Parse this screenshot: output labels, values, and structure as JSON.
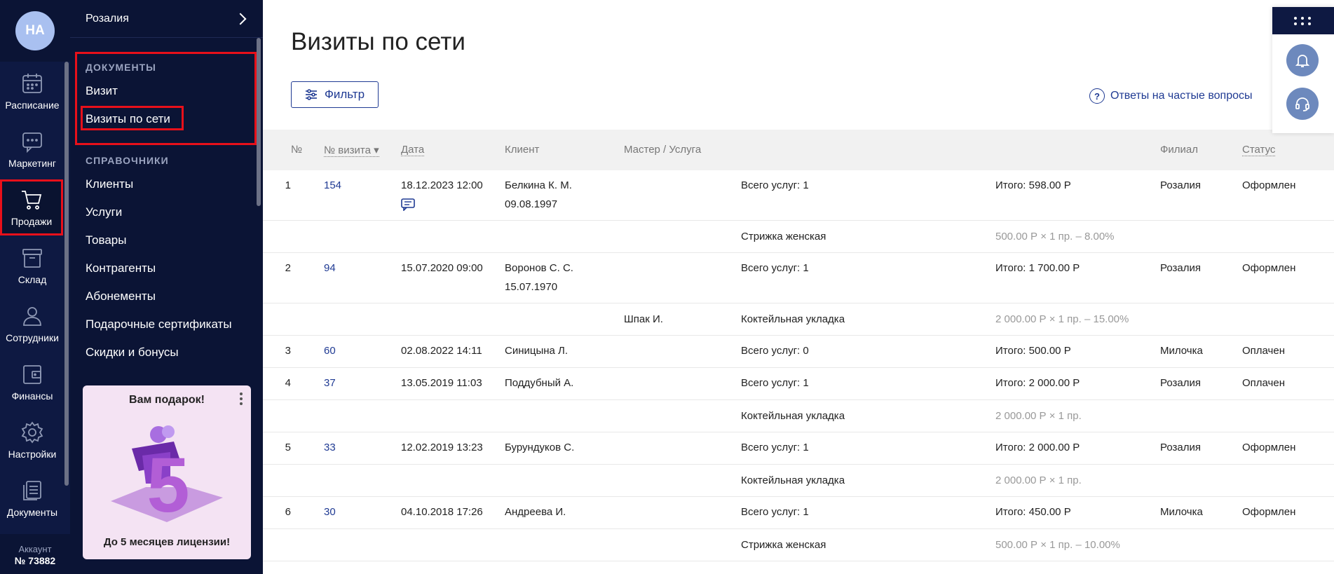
{
  "user": {
    "initials": "НА"
  },
  "rail": {
    "items": [
      {
        "label": "Расписание",
        "icon": "calendar-icon"
      },
      {
        "label": "Маркетинг",
        "icon": "chat-icon"
      },
      {
        "label": "Продажи",
        "icon": "cart-icon",
        "active": true
      },
      {
        "label": "Склад",
        "icon": "box-icon"
      },
      {
        "label": "Сотрудники",
        "icon": "person-icon"
      },
      {
        "label": "Финансы",
        "icon": "wallet-icon"
      },
      {
        "label": "Настройки",
        "icon": "gear-icon"
      },
      {
        "label": "Документы",
        "icon": "documents-icon"
      }
    ],
    "account_label": "Аккаунт",
    "account_number": "№ 73882"
  },
  "submenu": {
    "branch": "Розалия",
    "section_documents": "ДОКУМЕНТЫ",
    "documents": [
      "Визит",
      "Визиты по сети"
    ],
    "section_refs": "СПРАВОЧНИКИ",
    "refs": [
      "Клиенты",
      "Услуги",
      "Товары",
      "Контрагенты",
      "Абонементы",
      "Подарочные сертификаты",
      "Скидки и бонусы"
    ],
    "promo": {
      "title": "Вам подарок!",
      "digit": "5",
      "text": "До 5 месяцев лицензии!"
    }
  },
  "main": {
    "title": "Визиты по сети",
    "filter_label": "Фильтр",
    "faq_label": "Ответы на частые вопросы",
    "columns": [
      "№",
      "№ визита ▾",
      "Дата",
      "Клиент",
      "Мастер / Услуга",
      "Филиал",
      "Статус"
    ]
  },
  "rows": [
    {
      "n": "1",
      "visit": "154",
      "date": "18.12.2023 12:00",
      "client": "Белкина К. М.",
      "client2": "09.08.1997",
      "services": "Всего услуг: 1",
      "total": "Итого: 598.00 Р",
      "branch": "Розалия",
      "status": "Оформлен",
      "sub": [
        {
          "master": "",
          "service": "Стрижка женская",
          "price": "500.00 Р × 1 пр. – 8.00%"
        }
      ]
    },
    {
      "n": "2",
      "visit": "94",
      "date": "15.07.2020 09:00",
      "client": "Воронов С. С.",
      "client2": "15.07.1970",
      "services": "Всего услуг: 1",
      "total": "Итого: 1 700.00 Р",
      "branch": "Розалия",
      "status": "Оформлен",
      "sub": [
        {
          "master": "Шпак И.",
          "service": "Коктейльная укладка",
          "price": "2 000.00 Р × 1 пр. – 15.00%"
        }
      ]
    },
    {
      "n": "3",
      "visit": "60",
      "date": "02.08.2022 14:11",
      "client": "Синицына Л.",
      "client2": "",
      "services": "Всего услуг: 0",
      "total": "Итого: 500.00 Р",
      "branch": "Милочка",
      "status": "Оплачен",
      "sub": []
    },
    {
      "n": "4",
      "visit": "37",
      "date": "13.05.2019 11:03",
      "client": "Поддубный А.",
      "client2": "",
      "services": "Всего услуг: 1",
      "total": "Итого: 2 000.00 Р",
      "branch": "Розалия",
      "status": "Оплачен",
      "sub": [
        {
          "master": "",
          "service": "Коктейльная укладка",
          "price": "2 000.00 Р × 1 пр."
        }
      ]
    },
    {
      "n": "5",
      "visit": "33",
      "date": "12.02.2019 13:23",
      "client": "Бурундуков С.",
      "client2": "",
      "services": "Всего услуг: 1",
      "total": "Итого: 2 000.00 Р",
      "branch": "Розалия",
      "status": "Оформлен",
      "sub": [
        {
          "master": "",
          "service": "Коктейльная укладка",
          "price": "2 000.00 Р × 1 пр."
        }
      ]
    },
    {
      "n": "6",
      "visit": "30",
      "date": "04.10.2018 17:26",
      "client": "Андреева И.",
      "client2": "",
      "services": "Всего услуг: 1",
      "total": "Итого: 450.00 Р",
      "branch": "Милочка",
      "status": "Оформлен",
      "sub": [
        {
          "master": "",
          "service": "Стрижка женская",
          "price": "500.00 Р × 1 пр. – 10.00%"
        }
      ]
    }
  ]
}
